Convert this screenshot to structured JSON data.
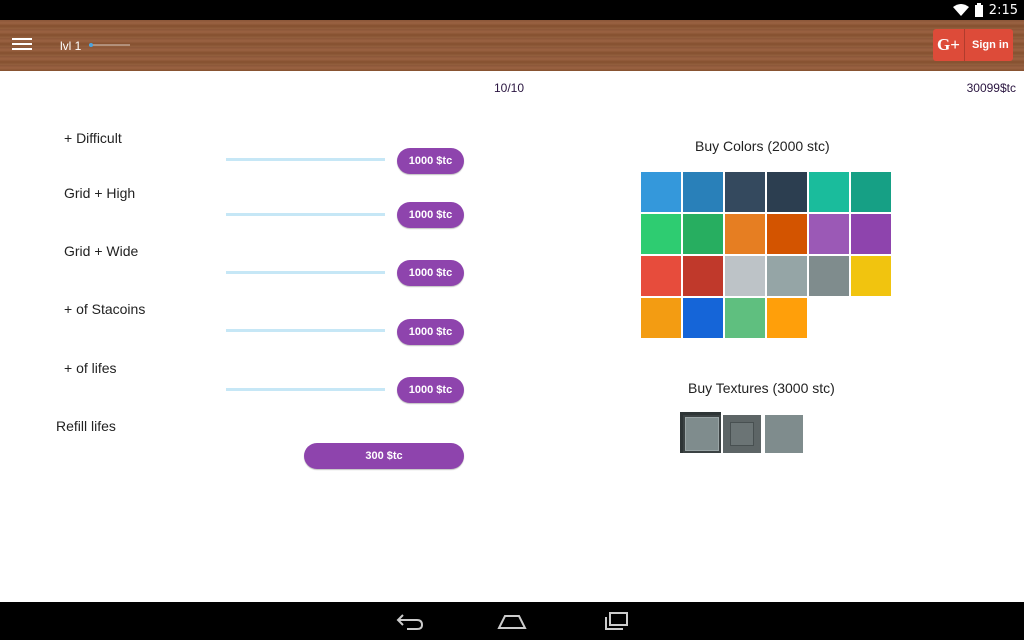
{
  "status_bar": {
    "time": "2:15"
  },
  "app_bar": {
    "level_label": "lvl 1",
    "level_progress": 0.1,
    "signin_icon": "G+",
    "signin_label": "Sign in"
  },
  "counters": {
    "lives": "10/10",
    "coins": "30099$tc"
  },
  "upgrades": [
    {
      "label": "+ Difficult",
      "price": "1000 $tc"
    },
    {
      "label": "Grid + High",
      "price": "1000 $tc"
    },
    {
      "label": "Grid + Wide",
      "price": "1000 $tc"
    },
    {
      "label": "+ of Stacoins",
      "price": "1000 $tc"
    },
    {
      "label": "+ of lifes",
      "price": "1000 $tc"
    }
  ],
  "refill": {
    "label": "Refill lifes",
    "price": "300 $tc"
  },
  "colors": {
    "title": "Buy Colors (2000 stc)",
    "swatches": [
      "#3498db",
      "#2980b9",
      "#34495e",
      "#2c3e50",
      "#1abc9c",
      "#16a085",
      "#2ecc71",
      "#27ae60",
      "#e67e22",
      "#d35400",
      "#9b59b6",
      "#8e44ad",
      "#e74c3c",
      "#c0392b",
      "#bdc3c7",
      "#95a5a6",
      "#7f8c8d",
      "#f1c40f",
      "#f39c12",
      "#1565d8",
      "#5fbf7f",
      "#ff9f0a"
    ]
  },
  "textures": {
    "title": "Buy Textures (3000 stc)",
    "count": 3
  },
  "theme": {
    "accent": "#8e44ad",
    "track": "#c6e7f6",
    "signin": "#dd4b39"
  }
}
